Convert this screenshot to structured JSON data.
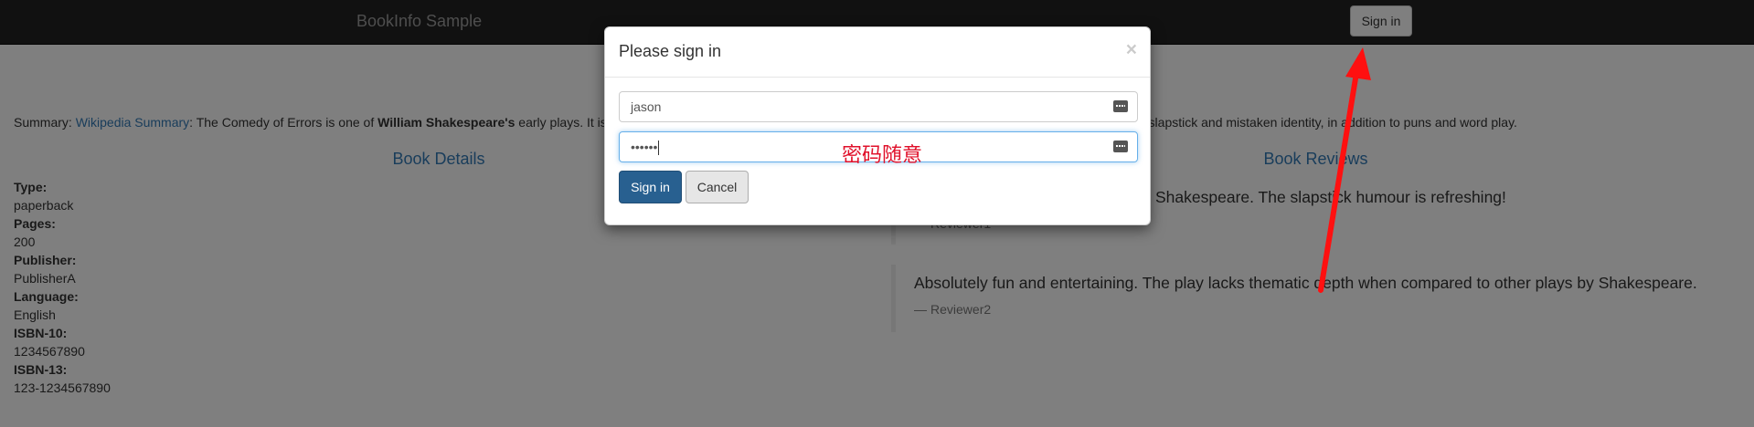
{
  "navbar": {
    "brand": "BookInfo Sample",
    "signin_label": "Sign in"
  },
  "summary": {
    "prefix": "Summary: ",
    "link": "Wikipedia Summary",
    "text1": ": The Comedy of Errors is one of ",
    "author": "William Shakespeare's",
    "text2": " early plays. It is",
    "tail": "m slapstick and mistaken identity, in addition to puns and word play."
  },
  "details": {
    "title": "Book Details",
    "items": [
      {
        "label": "Type:",
        "value": "paperback"
      },
      {
        "label": "Pages:",
        "value": "200"
      },
      {
        "label": "Publisher:",
        "value": "PublisherA"
      },
      {
        "label": "Language:",
        "value": "English"
      },
      {
        "label": "ISBN-10:",
        "value": "1234567890"
      },
      {
        "label": "ISBN-13:",
        "value": "123-1234567890"
      }
    ]
  },
  "reviews": {
    "title": "Book Reviews",
    "items": [
      {
        "text": "Shakespeare. The slapstick humour is refreshing!",
        "reviewer": "Reviewer1"
      },
      {
        "text": "Absolutely fun and entertaining. The play lacks thematic depth when compared to other plays by Shakespeare.",
        "reviewer": "Reviewer2"
      }
    ],
    "dash": "—"
  },
  "modal": {
    "title": "Please sign in",
    "close": "×",
    "username_value": "jason",
    "password_value": "••••••",
    "annotation": "密码随意",
    "signin_label": "Sign in",
    "cancel_label": "Cancel"
  },
  "colors": {
    "accent": "#337ab7",
    "primary_button": "#286090",
    "annotation_red": "#e0102a"
  },
  "icons": {
    "field_icon": "keyboard-key-icon",
    "close": "close-icon"
  }
}
